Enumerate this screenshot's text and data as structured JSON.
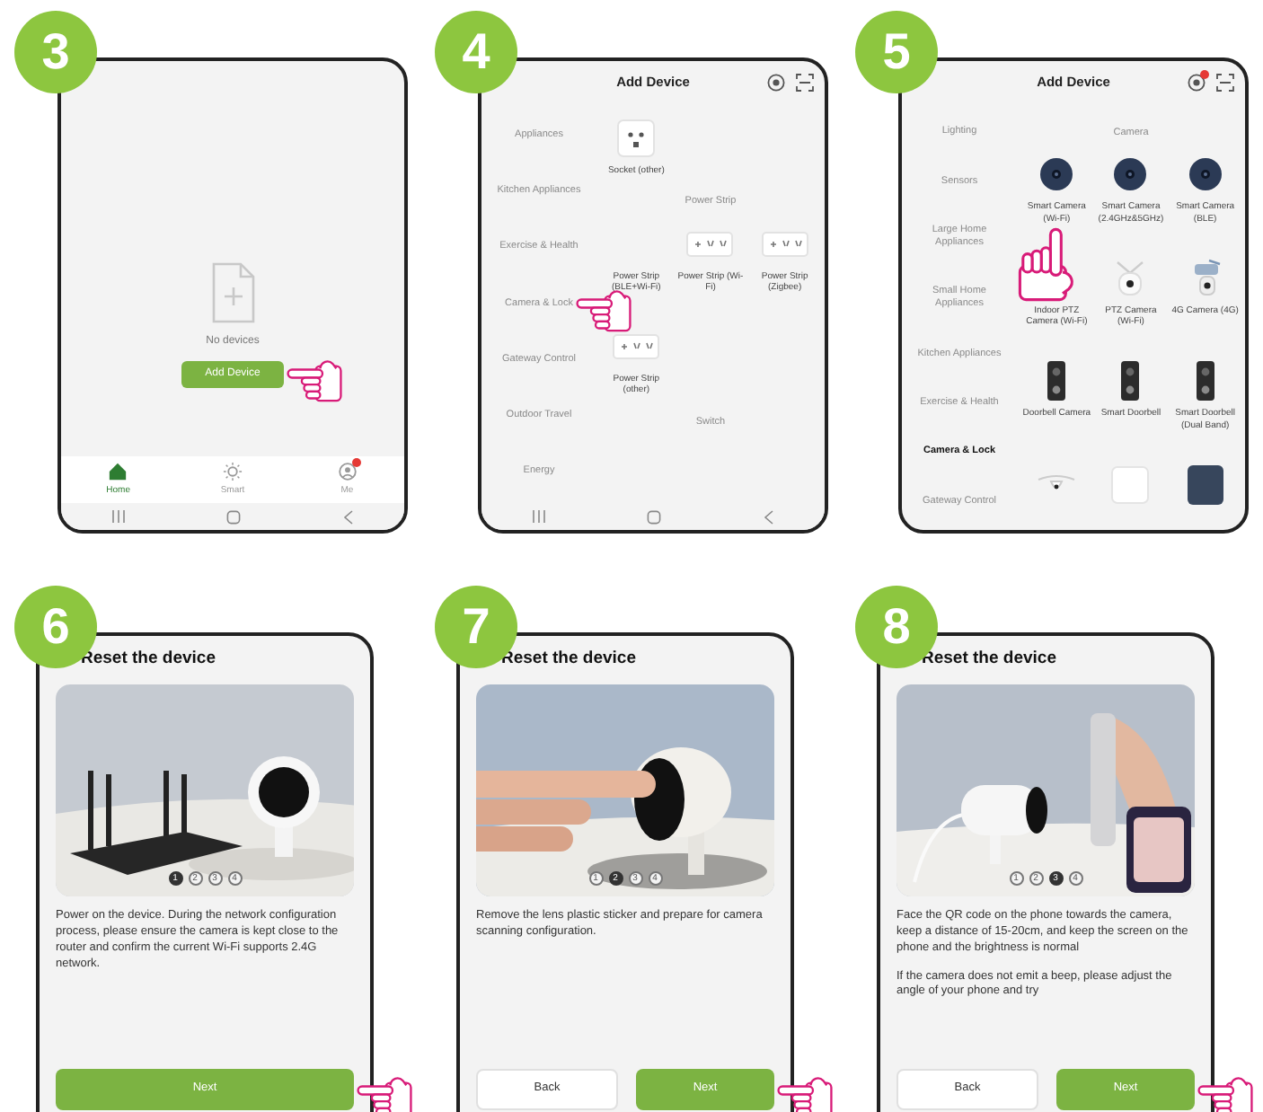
{
  "steps": [
    {
      "number": "3",
      "kind": "home",
      "system_nav": true,
      "empty_text": "No devices",
      "button": {
        "label": "Add Device",
        "tapped": true
      },
      "tabs": [
        {
          "label": "Home",
          "selected": true,
          "badge": false
        },
        {
          "label": "Smart",
          "selected": false,
          "badge": false
        },
        {
          "label": "Me",
          "selected": false,
          "badge": true
        }
      ]
    },
    {
      "number": "4",
      "kind": "catalog",
      "system_nav": true,
      "title": "Add Device",
      "categories": [
        {
          "label": "Appliances",
          "selected": false,
          "tapped": false
        },
        {
          "label": "Kitchen Appliances",
          "selected": false,
          "tapped": false
        },
        {
          "label": "Exercise & Health",
          "selected": false,
          "tapped": false
        },
        {
          "label": "Camera & Lock",
          "selected": false,
          "tapped": true
        },
        {
          "label": "Gateway Control",
          "selected": false,
          "tapped": false
        },
        {
          "label": "Outdoor Travel",
          "selected": false,
          "tapped": false
        },
        {
          "label": "Energy",
          "selected": false,
          "tapped": false
        }
      ],
      "sections": [
        {
          "items": [
            {
              "kind": "socket",
              "label": "Socket (other)",
              "tapped": false
            }
          ]
        },
        {
          "heading": "Power Strip",
          "items": [
            {
              "label": "Power Strip (BLE+Wi-Fi)",
              "tapped": false
            },
            {
              "kind": "power-strip",
              "label": "Power Strip (Wi-Fi)",
              "tapped": false
            },
            {
              "kind": "power-strip",
              "label": "Power Strip (Zigbee)",
              "tapped": false
            },
            {
              "kind": "power-strip",
              "label": "Power Strip (other)",
              "tapped": false
            }
          ]
        },
        {
          "heading": "Switch"
        }
      ]
    },
    {
      "number": "5",
      "kind": "catalog",
      "title": "Add Device",
      "notification": true,
      "categories": [
        {
          "label": "Lighting",
          "selected": false,
          "tapped": false
        },
        {
          "label": "Sensors",
          "selected": false,
          "tapped": false
        },
        {
          "label": "Large Home Appliances",
          "selected": false,
          "tapped": false
        },
        {
          "label": "Small Home Appliances",
          "selected": false,
          "tapped": false
        },
        {
          "label": "Kitchen Appliances",
          "selected": false,
          "tapped": false
        },
        {
          "label": "Exercise & Health",
          "selected": false,
          "tapped": false
        },
        {
          "label": "Camera & Lock",
          "selected": true,
          "tapped": false
        },
        {
          "label": "Gateway Control",
          "selected": false,
          "tapped": false
        }
      ],
      "sections": [
        {
          "heading": "Camera",
          "items": [
            {
              "kind": "camera",
              "label": "Smart Camera (Wi-Fi)",
              "tapped": true
            },
            {
              "kind": "camera",
              "label": "Smart Camera (2.4GHz&5GHz)",
              "tapped": false
            },
            {
              "kind": "camera",
              "label": "Smart Camera (BLE)",
              "tapped": false
            },
            {
              "label": "Indoor PTZ Camera (Wi-Fi)",
              "tapped": false
            },
            {
              "kind": "ptz",
              "label": "PTZ Camera (Wi-Fi)",
              "tapped": false
            },
            {
              "kind": "lte",
              "label": "4G Camera (4G)",
              "tapped": false
            },
            {
              "kind": "doorbell",
              "label": "Doorbell Camera",
              "tapped": false
            },
            {
              "kind": "doorbell",
              "label": "Smart Doorbell",
              "tapped": false
            },
            {
              "kind": "doorbell",
              "label": "Smart Doorbell (Dual Band)",
              "tapped": false
            },
            {
              "kind": "dome",
              "tapped": false
            },
            {
              "kind": "panel",
              "tapped": false
            },
            {
              "kind": "box",
              "tapped": false
            }
          ]
        }
      ]
    },
    {
      "number": "6",
      "kind": "reset",
      "title": "Reset the device",
      "media": {
        "kind": "picture"
      },
      "dots": [
        {
          "label": "1",
          "selected": true
        },
        {
          "label": "2",
          "selected": false
        },
        {
          "label": "3",
          "selected": false
        },
        {
          "label": "4",
          "selected": false
        }
      ],
      "paragraphs": [
        "Power on the device. During the network configuration process, please ensure the camera is kept close to the router and confirm the current Wi-Fi supports 2.4G network."
      ],
      "buttons": [
        {
          "label": "Next",
          "kind": "primary",
          "tapped": true
        }
      ]
    },
    {
      "number": "7",
      "kind": "reset",
      "title": "Reset the device",
      "media": {
        "kind": "picture"
      },
      "dots": [
        {
          "label": "1",
          "selected": false
        },
        {
          "label": "2",
          "selected": true
        },
        {
          "label": "3",
          "selected": false
        },
        {
          "label": "4",
          "selected": false
        }
      ],
      "paragraphs": [
        "Remove the lens plastic sticker and prepare for camera scanning configuration."
      ],
      "buttons": [
        {
          "label": "Back",
          "kind": "secondary",
          "tapped": false
        },
        {
          "label": "Next",
          "kind": "primary",
          "tapped": true
        }
      ]
    },
    {
      "number": "8",
      "kind": "reset",
      "title": "Reset the device",
      "media": {
        "kind": "picture"
      },
      "dots": [
        {
          "label": "1",
          "selected": false
        },
        {
          "label": "2",
          "selected": false
        },
        {
          "label": "3",
          "selected": true
        },
        {
          "label": "4",
          "selected": false
        }
      ],
      "paragraphs": [
        "Face the QR code on the phone towards the camera, keep a distance of 15-20cm, and keep the screen on the phone and the brightness is normal",
        "If the camera does not emit a beep, please adjust the angle of your phone and try"
      ],
      "buttons": [
        {
          "label": "Back",
          "kind": "secondary",
          "tapped": false
        },
        {
          "label": "Next",
          "kind": "primary",
          "tapped": true
        }
      ]
    }
  ]
}
